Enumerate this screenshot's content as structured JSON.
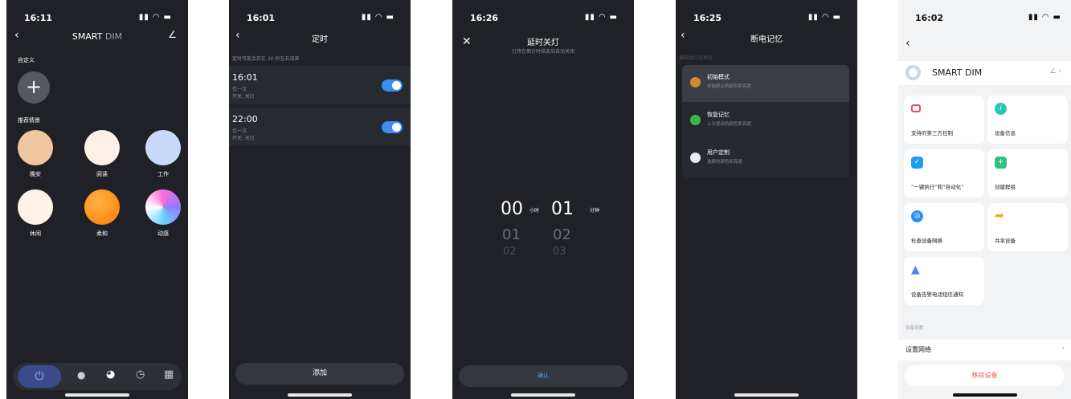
{
  "s1": {
    "time": "16:11",
    "title_a": "SMART",
    "title_b": "DIM",
    "custom_label": "自定义",
    "recommended_label": "推荐情景",
    "scenes": [
      {
        "label": "晚安",
        "color": "#efc6a0"
      },
      {
        "label": "阅读",
        "color": "#fdf0e8"
      },
      {
        "label": "工作",
        "color": "#c9d9f8"
      },
      {
        "label": "休闲",
        "color": "#fdf2ea"
      },
      {
        "label": "柔和",
        "color": "#ff9a2e"
      },
      {
        "label": "动感",
        "color": "#b58cf5"
      }
    ]
  },
  "s2": {
    "time": "16:01",
    "title": "定时",
    "note": "定时可能会存在 30 秒左右误差",
    "timers": [
      {
        "time": "16:01",
        "repeat": "仅一次",
        "action": "开关: 关灯"
      },
      {
        "time": "22:00",
        "repeat": "仅一次",
        "action": "开关: 关灯"
      }
    ],
    "add_label": "添加"
  },
  "s3": {
    "time": "16:26",
    "title": "延时关灯",
    "subtitle": "灯将在倒计时结束后自动关闭",
    "hour": "00",
    "hour_unit": "小时",
    "minute": "01",
    "minute_unit": "分钟",
    "next_hour": "01",
    "next_minute": "02",
    "next2_hour": "02",
    "next2_minute": "03",
    "confirm": "确认"
  },
  "s4": {
    "time": "16:25",
    "title": "断电记忆",
    "section": "通电后灯光状态",
    "options": [
      {
        "title": "初始模式",
        "desc": "初始默认的颜色和亮度"
      },
      {
        "title": "恢复记忆",
        "desc": "上次使用的颜色和亮度"
      },
      {
        "title": "用户定制",
        "desc": "选择的颜色和亮度"
      }
    ]
  },
  "s5": {
    "time": "16:02",
    "device_name": "SMART DIM",
    "cards": [
      {
        "label": "支持的第三方控制",
        "color": "#e94a6a"
      },
      {
        "label": "设备信息",
        "color": "#26c6b8"
      },
      {
        "label": "“一键执行”和“自动化”",
        "color": "#1e9cf0"
      },
      {
        "label": "创建群组",
        "color": "#2ec27e"
      },
      {
        "label": "检查设备网络",
        "color": "#2b8ff0"
      },
      {
        "label": "共享设备",
        "color": "#f5a623"
      },
      {
        "label": "设备告警电话短信通知",
        "color": "#3d8af7"
      }
    ],
    "section": "设备设置",
    "network_label": "设置网络",
    "remove_label": "移除设备"
  }
}
